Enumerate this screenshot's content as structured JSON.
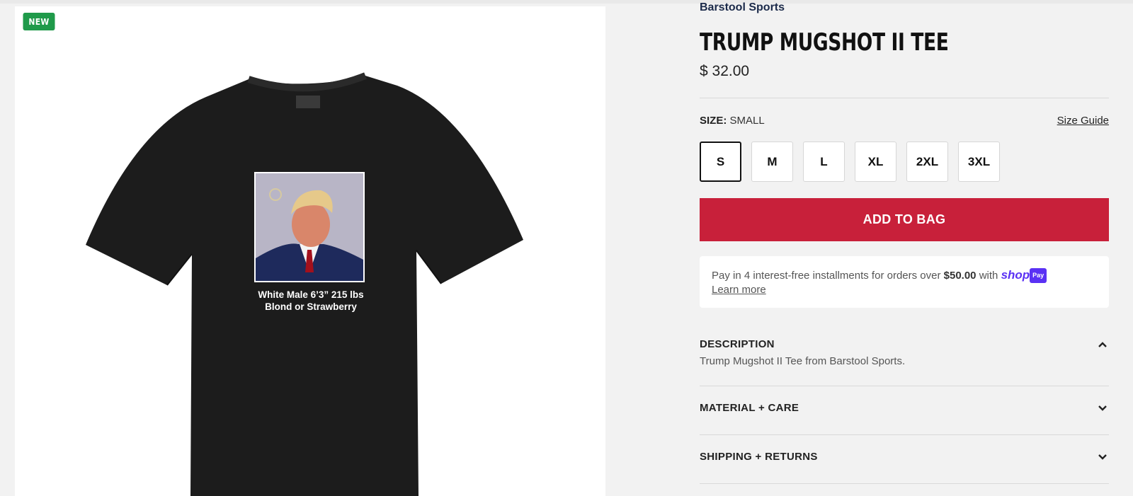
{
  "badge": {
    "label": "NEW"
  },
  "product_image": {
    "print_line_1": "White Male 6’3” 215 lbs",
    "print_line_2": "Blond or Strawberry"
  },
  "product": {
    "brand": "Barstool Sports",
    "title": "TRUMP MUGSHOT II TEE",
    "price": "$ 32.00"
  },
  "size": {
    "label": "SIZE:",
    "selected_value": "SMALL",
    "guide_label": "Size Guide",
    "options": [
      "S",
      "M",
      "L",
      "XL",
      "2XL",
      "3XL"
    ]
  },
  "add_to_bag": "ADD TO BAG",
  "shoppay": {
    "text_prefix": "Pay in 4 interest-free installments for orders over",
    "amount": "$50.00",
    "text_suffix": "with",
    "logo": "shop",
    "chip": "Pay",
    "learn_more": "Learn more"
  },
  "accordion": {
    "description": {
      "title": "DESCRIPTION",
      "body": "Trump Mugshot II Tee from Barstool Sports.",
      "icon": "chevron-up-icon"
    },
    "material": {
      "title": "MATERIAL + CARE",
      "icon": "chevron-down-icon"
    },
    "shipping": {
      "title": "SHIPPING + RETURNS",
      "icon": "chevron-down-icon"
    }
  },
  "colors": {
    "accent_red": "#c8203a",
    "badge_green": "#1f9a4a",
    "shoppay_purple": "#5a31f4"
  }
}
